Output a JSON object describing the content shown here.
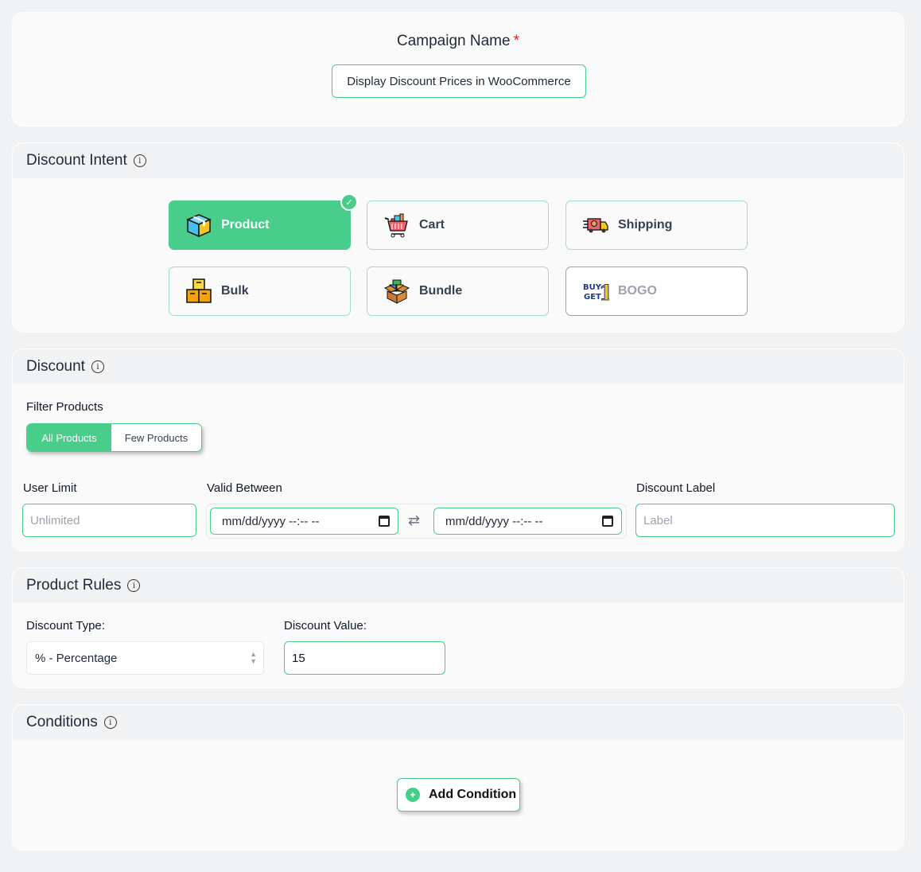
{
  "campaign": {
    "label": "Campaign Name",
    "required_mark": "*",
    "value": "Display Discount Prices in WooCommerce"
  },
  "intent": {
    "title": "Discount Intent",
    "options": [
      {
        "label": "Product",
        "icon": "product-box-icon",
        "state": "selected"
      },
      {
        "label": "Cart",
        "icon": "shopping-cart-icon",
        "state": "normal"
      },
      {
        "label": "Shipping",
        "icon": "delivery-truck-icon",
        "state": "normal"
      },
      {
        "label": "Bulk",
        "icon": "stacked-boxes-icon",
        "state": "normal"
      },
      {
        "label": "Bundle",
        "icon": "open-box-icon",
        "state": "normal"
      },
      {
        "label": "BOGO",
        "icon": "buy-get-one-icon",
        "state": "disabled"
      }
    ],
    "check_glyph": "✓"
  },
  "discount": {
    "title": "Discount",
    "filter_label": "Filter Products",
    "filter_options": [
      "All Products",
      "Few Products"
    ],
    "filter_selected": "All Products",
    "user_limit_label": "User Limit",
    "user_limit_placeholder": "Unlimited",
    "valid_between_label": "Valid Between",
    "start_date": "mm/dd/yyyy --:-- --",
    "end_date": "mm/dd/yyyy --:-- --",
    "swap_glyph": "⇄",
    "label_label": "Discount Label",
    "label_placeholder": "Label"
  },
  "rules": {
    "title": "Product Rules",
    "type_label": "Discount Type:",
    "type_value": "% - Percentage",
    "value_label": "Discount Value:",
    "value": "15"
  },
  "conditions": {
    "title": "Conditions",
    "add_button": "Add Condition",
    "plus_glyph": "+"
  },
  "colors": {
    "accent": "#48cd8a",
    "required": "#e02424"
  },
  "info_glyph": "i"
}
